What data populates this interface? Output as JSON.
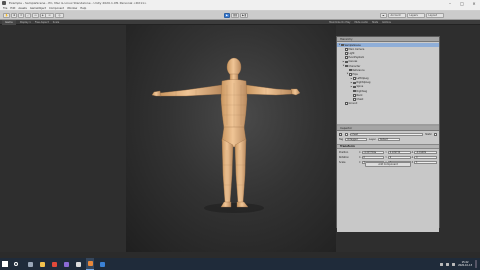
{
  "window": {
    "title": "Example - SampleScene - PC, Mac & Linux Standalone - Unity 2020.1.0f1 Personal <DX11>"
  },
  "menu": [
    "File",
    "Edit",
    "Assets",
    "GameObject",
    "Component",
    "Window",
    "Help"
  ],
  "toolbar": {
    "account_label": "Account",
    "layers_label": "Layers",
    "layout_label": "Layout"
  },
  "scene_header": {
    "tab_label": "Game",
    "display_label": "Display 1",
    "resolution_label": "Free Aspect",
    "scale_label": "Scale",
    "maximize_label": "Maximize On Play",
    "mute_label": "Mute Audio",
    "stats_label": "Stats",
    "gizmos_label": "Gizmos"
  },
  "hierarchy": {
    "tab_label": "Hierarchy",
    "rows": [
      {
        "label": "SampleScene",
        "indent": 0,
        "arrow": "▼",
        "selected": true
      },
      {
        "label": "Main Camera",
        "indent": 1,
        "arrow": ""
      },
      {
        "label": "Light",
        "indent": 1,
        "arrow": ""
      },
      {
        "label": "EventSystem",
        "indent": 1,
        "arrow": ""
      },
      {
        "label": "Canvas",
        "indent": 1,
        "arrow": "▶"
      },
      {
        "label": "Character",
        "indent": 1,
        "arrow": "▼"
      },
      {
        "label": "Reference",
        "indent": 2,
        "arrow": ""
      },
      {
        "label": "Hips",
        "indent": 2,
        "arrow": "▼"
      },
      {
        "label": "LeftUpLeg",
        "indent": 3,
        "arrow": "▶"
      },
      {
        "label": "RightUpLeg",
        "indent": 3,
        "arrow": "▶"
      },
      {
        "label": "Spine",
        "indent": 3,
        "arrow": "▶"
      },
      {
        "label": "RightLeg",
        "indent": 3,
        "arrow": ""
      },
      {
        "label": "Neck",
        "indent": 3,
        "arrow": ""
      },
      {
        "label": "Chest",
        "indent": 3,
        "arrow": ""
      },
      {
        "label": "Ground",
        "indent": 1,
        "arrow": ""
      }
    ]
  },
  "inspector": {
    "tab_label": "Inspector",
    "object_name": "Chest",
    "static_label": "Static",
    "tag_label": "Tag",
    "tag_value": "Untagged",
    "layer_label": "Layer",
    "layer_value": "Default",
    "transform_label": "Transform",
    "position_label": "Position",
    "rotation_label": "Rotation",
    "scale_label": "Scale",
    "position": {
      "x": "-4.413794e",
      "y": "0.109734",
      "z": "-0.01499"
    },
    "rotation": {
      "x": "0",
      "y": "0",
      "z": "0"
    },
    "scale": {
      "x": "1",
      "y": "1",
      "z": "1"
    },
    "add_component_label": "Add Component"
  },
  "taskbar": {
    "time": "15:22",
    "date": "2020-10-13",
    "apps": [
      {
        "name": "task-view",
        "color": "#9aa7b8"
      },
      {
        "name": "file-explorer",
        "color": "#f2c14e"
      },
      {
        "name": "chrome",
        "color": "#e0493a"
      },
      {
        "name": "visual-studio",
        "color": "#8c6bd6"
      },
      {
        "name": "unity-hub",
        "color": "#dddddd"
      },
      {
        "name": "unity",
        "color": "#e8883a"
      },
      {
        "name": "mail",
        "color": "#3b82d6"
      }
    ]
  },
  "colors": {
    "skin": "#e8b98a",
    "skin_shadow": "#b98a5e",
    "selection": "#8faed8",
    "play_active": "#3d7fd6"
  }
}
